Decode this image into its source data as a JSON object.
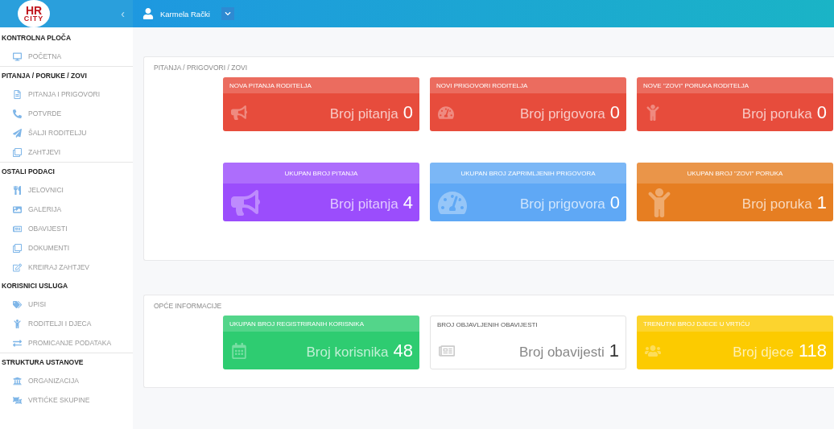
{
  "logo": {
    "line1": "HR",
    "line2": "CITY"
  },
  "header": {
    "collapse": "‹",
    "user": "Karmela Rački"
  },
  "sidebar": [
    {
      "heading": "KONTROLNA PLOČA",
      "items": [
        "POČETNA"
      ]
    },
    {
      "heading": "PITANJA / PORUKE / ZOVI",
      "items": [
        "PITANJA I PRIGOVORI",
        "POTVRDE",
        "ŠALJI RODITELJU",
        "ZAHTJEVI"
      ]
    },
    {
      "heading": "OSTALI PODACI",
      "items": [
        "JELOVNICI",
        "GALERIJA",
        "OBAVIJESTI",
        "DOKUMENTI",
        "KREIRAJ ZAHTJEV"
      ]
    },
    {
      "heading": "KORISNICI USLUGA",
      "items": [
        "UPISI",
        "RODITELJI I DJECA",
        "PROMICANJE PODATAKA"
      ]
    },
    {
      "heading": "STRUKTURA USTANOVE",
      "items": [
        "ORGANIZACIJA",
        "VRTIĆKE SKUPINE"
      ]
    }
  ],
  "sections": [
    {
      "title": "PITANJA / PRIGOVORI / ZOVI",
      "cards": [
        {
          "kind": "alert",
          "color": "#e74c3c",
          "title": "NOVA PITANJA RODITELJA",
          "label": "Broj pitanja",
          "count": "0"
        },
        {
          "kind": "alert",
          "color": "#e74c3c",
          "title": "NOVI PRIGOVORI RODITELJA",
          "label": "Broj prigovora",
          "count": "0"
        },
        {
          "kind": "alert",
          "color": "#e74c3c",
          "title": "NOVE \"ZOVI\" PORUKA RODITELJA",
          "label": "Broj poruka",
          "count": "0"
        },
        {
          "kind": "total",
          "color": "#9b4dfc",
          "title": "UKUPAN BROJ PITANJA",
          "label": "Broj pitanja",
          "count": "4"
        },
        {
          "kind": "total",
          "color": "#5fa8f5",
          "title": "UKUPAN BROJ ZAPRIMLJENIH PRIGOVORA",
          "label": "Broj prigovora",
          "count": "0"
        },
        {
          "kind": "total",
          "color": "#e67e22",
          "title": "UKUPAN BROJ \"ZOVI\" PORUKA",
          "label": "Broj poruka",
          "count": "1"
        }
      ]
    },
    {
      "title": "OPĆE INFORMACIJE",
      "cards": [
        {
          "kind": "stat",
          "color": "#2ecc71",
          "title": "UKUPAN BROJ REGISTRIRANIH KORISNIKA",
          "label": "Broj korisnika",
          "count": "48"
        },
        {
          "kind": "plain",
          "color": "#ffffff",
          "title": "BROJ OBJAVLJENIH OBAVIJESTI",
          "label": "Broj obavijesti",
          "count": "1"
        },
        {
          "kind": "stat",
          "color": "#fccb00",
          "title": "TRENUTNI BROJ DJECE U VRTIĆU",
          "label": "Broj djece",
          "count": "118"
        }
      ]
    }
  ]
}
